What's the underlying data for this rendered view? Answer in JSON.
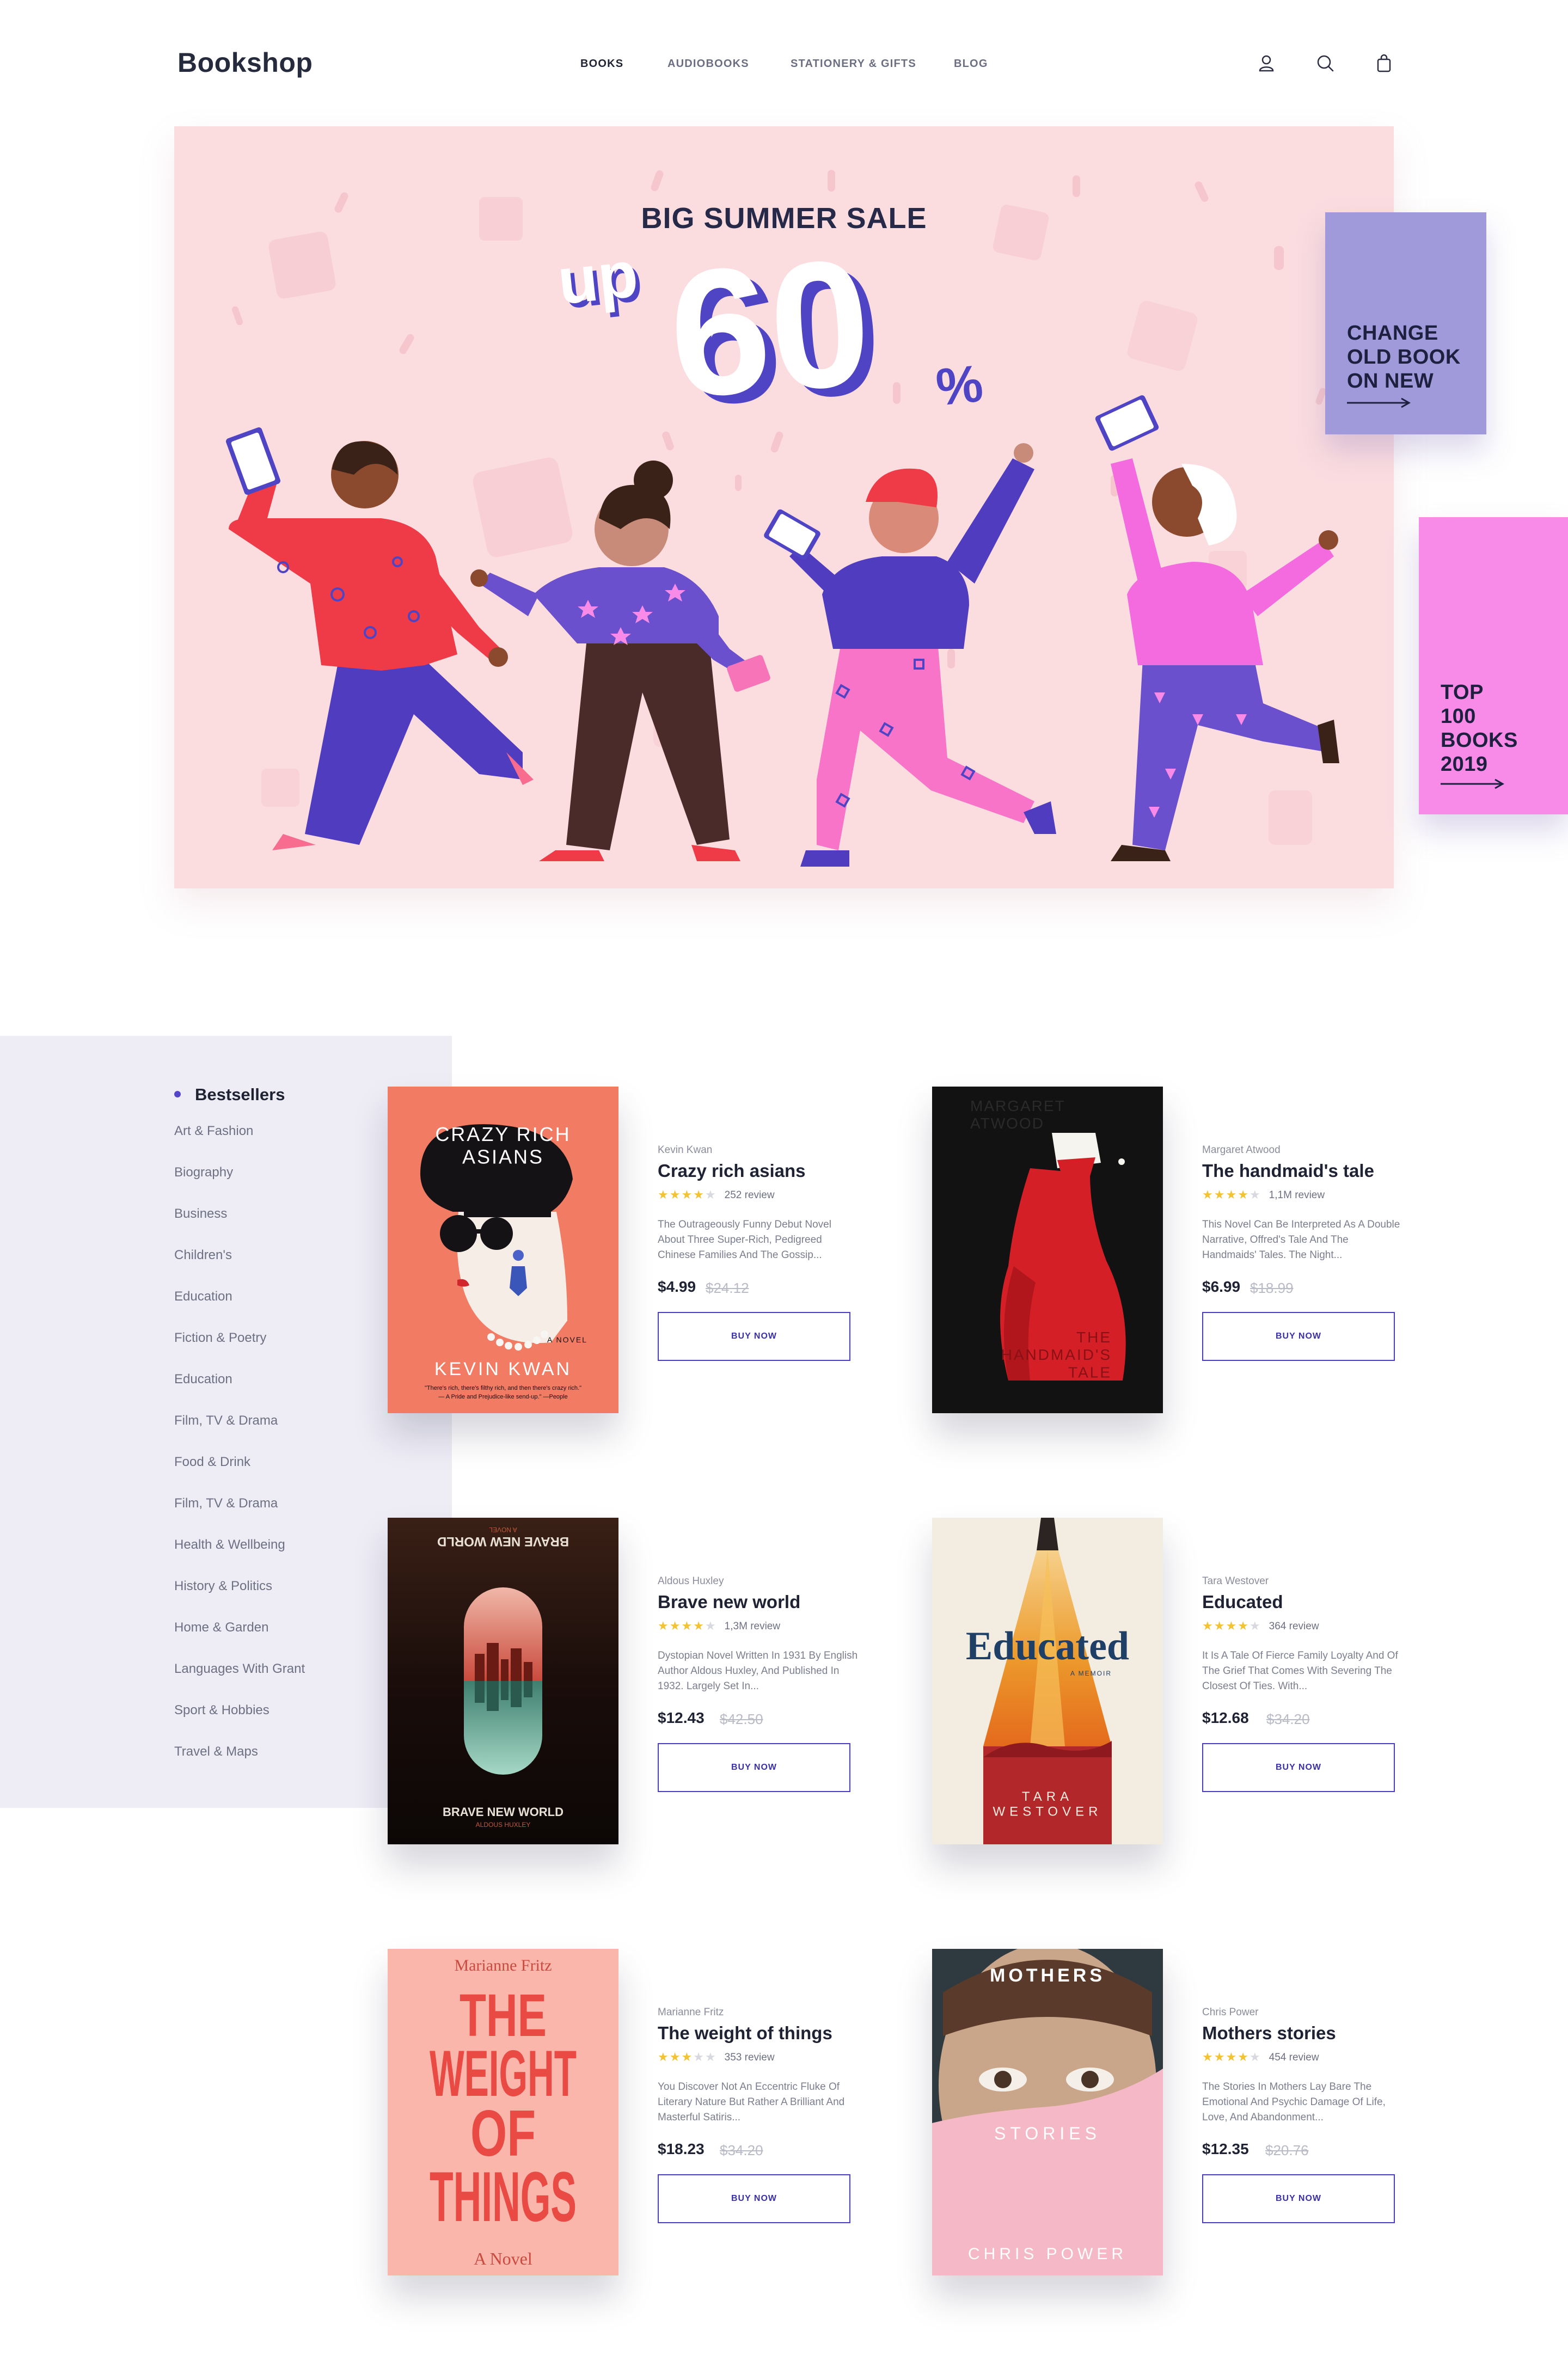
{
  "header": {
    "logo": "Bookshop",
    "nav": [
      "BOOKS",
      "AUDIOBOOKS",
      "STATIONERY & GIFTS",
      "BLOG"
    ],
    "active_nav": "BOOKS",
    "icons": [
      "user-icon",
      "search-icon",
      "bag-icon"
    ]
  },
  "hero": {
    "title": "BIG SUMMER SALE",
    "prefix": "up",
    "number": "60",
    "suffix": "%",
    "colors": {
      "background": "#fbdde0",
      "accent": "#5446c9"
    }
  },
  "promos": {
    "change": {
      "text": "CHANGE\nOLD BOOK\nON NEW",
      "color": "#a09adb"
    },
    "top": {
      "text": "TOP\n100\nBOOKS\n2019",
      "color": "#f88be8"
    }
  },
  "categories": {
    "title": "Bestsellers",
    "items": [
      "Art & Fashion",
      "Biography",
      "Business",
      "Children's",
      "Education",
      "Fiction & Poetry",
      "Education",
      "Film, TV & Drama",
      "Food & Drink",
      "Film, TV & Drama",
      "Health & Wellbeing",
      "History & Politics",
      "Home & Garden",
      "Languages With Grant",
      "Sport & Hobbies",
      "Travel & Maps"
    ]
  },
  "books": [
    {
      "author": "Kevin Kwan",
      "title": "Crazy rich asians",
      "stars": 4,
      "reviews": "252 review",
      "description": "The Outrageously Funny Debut Novel About Three Super-Rich, Pedigreed Chinese Families And The Gossip...",
      "price": "$4.99",
      "old_price": "$24.12",
      "button": "BUY NOW",
      "cover": {
        "title": "CRAZY RICH\nASIANS",
        "author": "KEVIN KWAN",
        "tag": "A NOVEL",
        "quote": "\"There's rich, there's filthy rich, and then there's crazy rich.\"",
        "quote_src": "— A Pride and Prejudice-like send-up.\" —People"
      }
    },
    {
      "author": "Margaret Atwood",
      "title": "The handmaid's tale",
      "stars": 4,
      "reviews": "1,1M review",
      "description": "This Novel Can Be Interpreted As A Double Narrative, Offred's Tale And The Handmaids' Tales. The Night...",
      "price": "$6.99",
      "old_price": "$18.99",
      "button": "BUY NOW",
      "cover": {
        "author": "MARGARET\nATWOOD",
        "title": "THE\nHANDMAID'S\nTALE"
      }
    },
    {
      "author": "Aldous Huxley",
      "title": "Brave new world",
      "stars": 4,
      "reviews": "1,3M review",
      "description": "Dystopian Novel Written In 1931 By English Author Aldous Huxley, And Published In 1932. Largely Set In...",
      "price": "$12.43",
      "old_price": "$42.50",
      "button": "BUY NOW",
      "cover": {
        "title": "BRAVE NEW WORLD",
        "author": "ALDOUS HUXLEY",
        "tag": "A NOVEL"
      }
    },
    {
      "author": "Tara Westover",
      "title": "Educated",
      "stars": 4,
      "reviews": "364 review",
      "description": "It Is A Tale Of Fierce Family Loyalty And Of The Grief That Comes With Severing The Closest Of Ties. With...",
      "price": "$12.68",
      "old_price": "$34.20",
      "button": "BUY NOW",
      "cover": {
        "title": "Educated",
        "tag": "A MEMOIR",
        "author": "TARA\nWESTOVER"
      }
    },
    {
      "author": "Marianne Fritz",
      "title": "The weight of things",
      "stars": 3,
      "reviews": "353 review",
      "description": "You Discover Not An Eccentric Fluke Of Literary Nature But Rather A Brilliant And Masterful Satiris...",
      "price": "$18.23",
      "old_price": "$34.20",
      "button": "BUY NOW",
      "cover": {
        "author": "Marianne Fritz",
        "title": "THE\nWEIGHT\nOF\nTHINGS",
        "tag": "A Novel"
      }
    },
    {
      "author": "Chris Power",
      "title": "Mothers stories",
      "stars": 4,
      "reviews": "454 review",
      "description": "The Stories In Mothers Lay Bare The Emotional And Psychic Damage Of Life, Love, And Abandonment...",
      "price": "$12.35",
      "old_price": "$20.76",
      "button": "BUY NOW",
      "cover": {
        "title": "MOTHERS",
        "subtitle": "STORIES",
        "author": "CHRIS POWER"
      }
    }
  ]
}
